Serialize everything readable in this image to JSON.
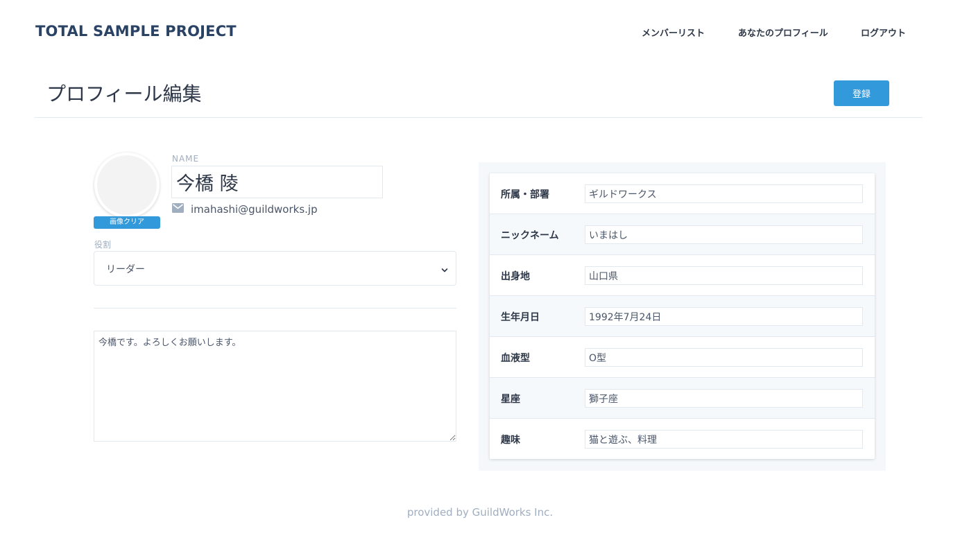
{
  "header": {
    "app_title": "TOTAL SAMPLE PROJECT",
    "nav": [
      {
        "label": "メンバーリスト"
      },
      {
        "label": "あなたのプロフィール"
      },
      {
        "label": "ログアウト"
      }
    ]
  },
  "page": {
    "title": "プロフィール編集",
    "submit_label": "登録"
  },
  "profile": {
    "clear_image_label": "画像クリア",
    "name_label": "NAME",
    "name_value": "今橋 陵",
    "email": "imahashi@guildworks.jp",
    "role_label": "役割",
    "role_value": "リーダー",
    "bio": "今橋です。よろしくお願いします。"
  },
  "details": [
    {
      "label": "所属・部署",
      "value": "ギルドワークス"
    },
    {
      "label": "ニックネーム",
      "value": "いまはし"
    },
    {
      "label": "出身地",
      "value": "山口県"
    },
    {
      "label": "生年月日",
      "value": "1992年7月24日"
    },
    {
      "label": "血液型",
      "value": "O型"
    },
    {
      "label": "星座",
      "value": "獅子座"
    },
    {
      "label": "趣味",
      "value": "猫と遊ぶ、料理"
    }
  ],
  "footer": {
    "text": "provided by GuildWorks Inc."
  },
  "colors": {
    "accent": "#3299db",
    "title": "#2a4365",
    "muted": "#a0aec0",
    "panel_bg": "#f5f8fb"
  },
  "icons": {
    "email": "mail-icon",
    "select": "chevron-down-icon"
  }
}
